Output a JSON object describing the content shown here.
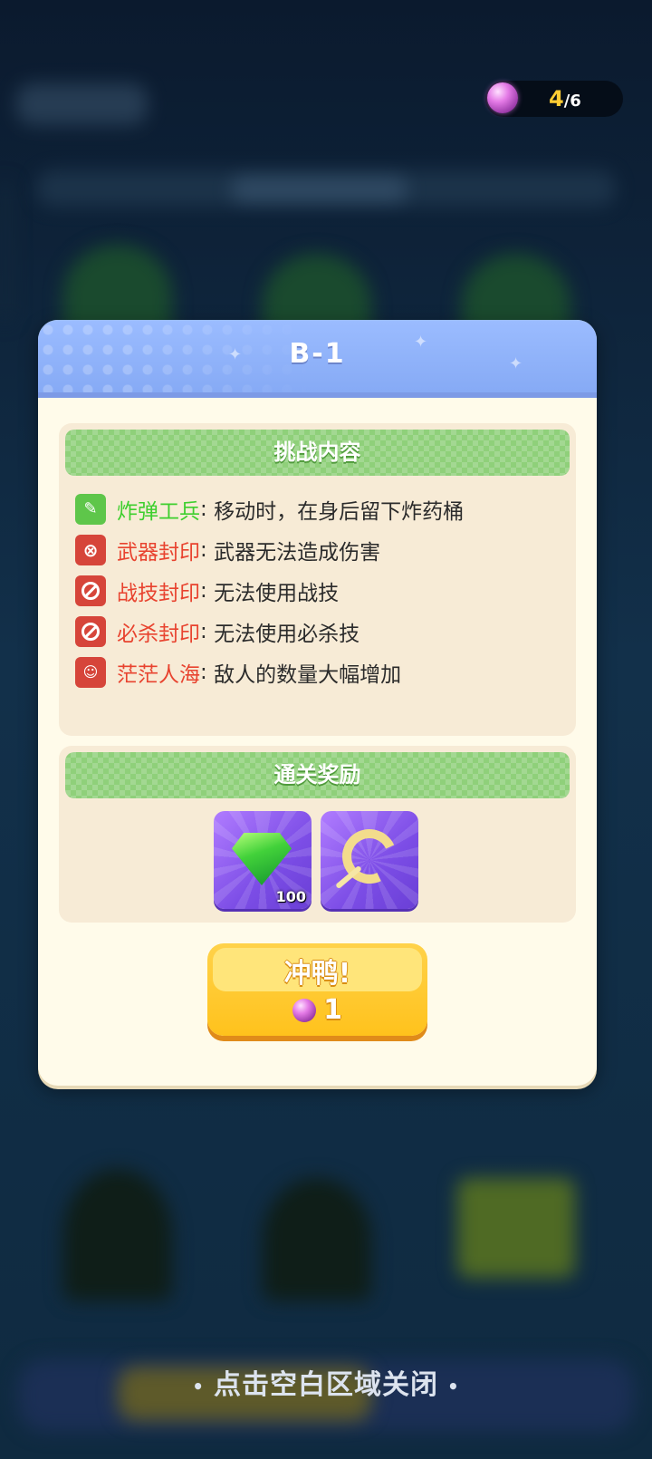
{
  "counter": {
    "current": "4",
    "separator": "/",
    "max": "6"
  },
  "modal": {
    "title": "B-1",
    "challenge": {
      "heading": "挑战内容",
      "items": [
        {
          "name": "炸弹工兵",
          "colon": ":",
          "desc": "移动时，在身后留下炸药桶",
          "color": "#3ecf2e",
          "icon": "bomb-engineer-icon"
        },
        {
          "name": "武器封印",
          "colon": ":",
          "desc": "武器无法造成伤害",
          "color": "#e8432f",
          "icon": "weapon-seal-icon"
        },
        {
          "name": "战技封印",
          "colon": ":",
          "desc": "无法使用战技",
          "color": "#e8432f",
          "icon": "skill-seal-icon"
        },
        {
          "name": "必杀封印",
          "colon": ":",
          "desc": "无法使用必杀技",
          "color": "#e8432f",
          "icon": "ultimate-seal-icon"
        },
        {
          "name": "茫茫人海",
          "colon": ":",
          "desc": "敌人的数量大幅增加",
          "color": "#e8432f",
          "icon": "crowd-icon"
        }
      ]
    },
    "reward": {
      "heading": "通关奖励",
      "items": [
        {
          "icon": "green-gem-icon",
          "quantity": "100"
        },
        {
          "icon": "golden-hook-icon",
          "quantity": ""
        }
      ]
    },
    "go_button": {
      "label": "冲鸭!",
      "cost": "1"
    }
  },
  "close_hint": "点击空白区域关闭"
}
